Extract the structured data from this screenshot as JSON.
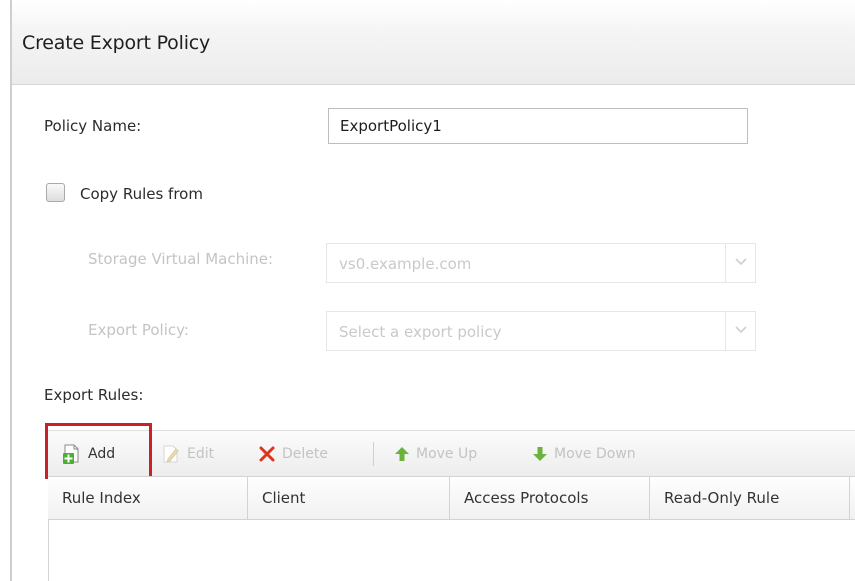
{
  "dialog": {
    "title": "Create Export Policy"
  },
  "form": {
    "policy_name_label": "Policy Name:",
    "policy_name_value": "ExportPolicy1",
    "copy_rules_label": "Copy Rules from",
    "copy_rules_checked": false,
    "svm_label": "Storage Virtual Machine:",
    "svm_value": "vs0.example.com",
    "export_policy_label": "Export Policy:",
    "export_policy_placeholder": "Select a export policy"
  },
  "rules": {
    "section_label": "Export Rules:",
    "toolbar": {
      "add": "Add",
      "edit": "Edit",
      "delete": "Delete",
      "move_up": "Move Up",
      "move_down": "Move Down"
    },
    "columns": [
      "Rule Index",
      "Client",
      "Access Protocols",
      "Read-Only Rule"
    ]
  },
  "colors": {
    "highlight": "#c82127",
    "add_icon_green": "#4caf32",
    "delete_icon_red": "#d9361c",
    "move_icon_green": "#6cb33e"
  }
}
